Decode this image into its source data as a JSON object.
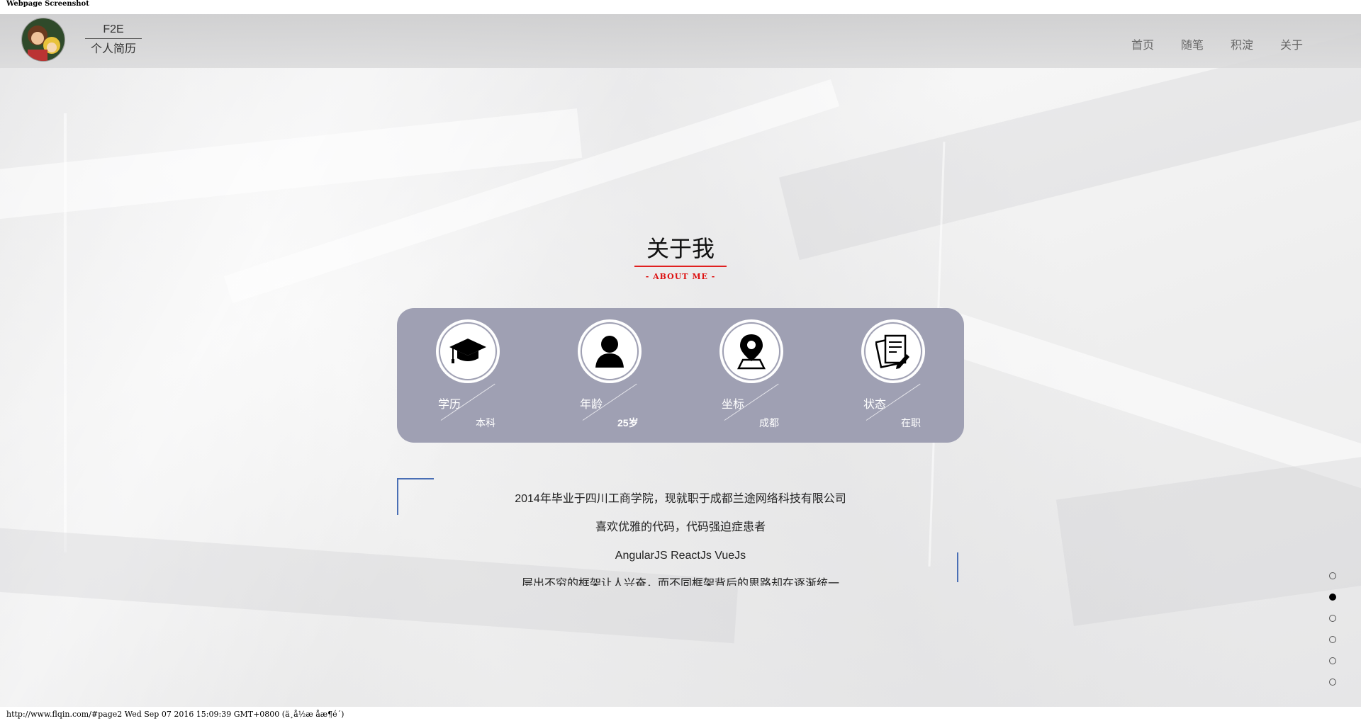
{
  "print": {
    "title": "Webpage Screenshot",
    "footer": "http://www.flqin.com/#page2 Wed Sep 07 2016 15:09:39 GMT+0800 (ä¸­å½æ åæ¶é´)"
  },
  "header": {
    "brand_top": "F2E",
    "brand_bottom": "个人简历",
    "nav": [
      "首页",
      "随笔",
      "积淀",
      "关于"
    ]
  },
  "section": {
    "title": "关于我",
    "subtitle": "- ABOUT ME -"
  },
  "info_items": [
    {
      "label": "学历",
      "value": "本科",
      "icon": "graduation-cap-icon"
    },
    {
      "label": "年龄",
      "value": "25岁",
      "icon": "person-icon"
    },
    {
      "label": "坐标",
      "value": "成都",
      "icon": "map-pin-icon"
    },
    {
      "label": "状态",
      "value": "在职",
      "icon": "document-edit-icon"
    }
  ],
  "intro_lines": [
    "2014年毕业于四川工商学院，现就职于成都兰途网络科技有限公司",
    "喜欢优雅的代码，代码强迫症患者",
    "AngularJS ReactJs VueJs",
    "层出不穷的框架让人兴奋，而不同框架背后的思路却在逐渐统一"
  ],
  "pager": {
    "count": 6,
    "active_index": 1
  },
  "colors": {
    "card": "#9fa0b3",
    "accent_red": "#e02020",
    "corner_blue": "#4a6fb5"
  }
}
